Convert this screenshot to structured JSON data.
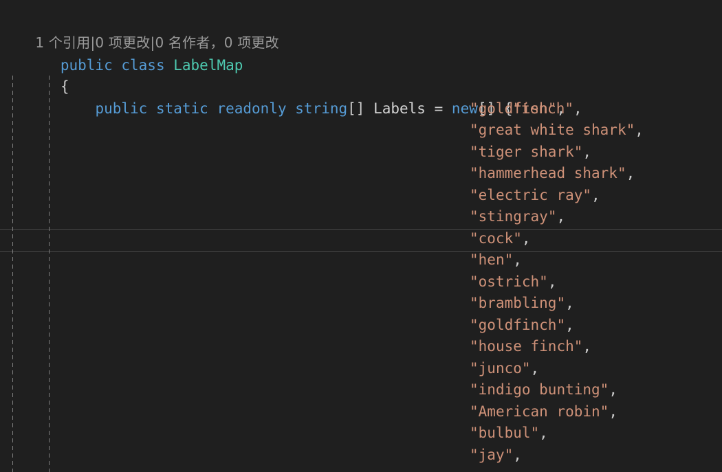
{
  "editor": {
    "language": "csharp",
    "background_color": "#1f1f1f",
    "font_size_px": 21,
    "line_height_px": 31.5,
    "current_line_number": 10,
    "colors": {
      "background": "#1f1f1f",
      "keyword": "#569cd6",
      "type_name": "#4ec9b0",
      "string": "#ce9178",
      "plain_text": "#d4d4d4",
      "punctuation": "#cccccc",
      "codelens": "#9a9a9a",
      "indent_guide": "#808080",
      "current_line_border": "#4a4a4a"
    }
  },
  "codelens": {
    "full_text": "1 个引用|0 项更改|0 名作者，0 项更改",
    "references": "1 个引用",
    "separator": "|",
    "changes": "0 项更改",
    "authors": "0 名作者，0 项更改"
  },
  "code": {
    "class_declaration": {
      "modifier": "public",
      "keyword": "class",
      "name": "LabelMap"
    },
    "open_brace": "{",
    "field_declaration": {
      "modifier1": "public",
      "modifier2": "static",
      "modifier3": "readonly",
      "type": "string",
      "array_suffix": "[]",
      "name": "Labels",
      "equals": "=",
      "new_keyword": "new",
      "new_suffix": "[]",
      "init_open": "{"
    },
    "quote": "\"",
    "comma": ",",
    "array_values": [
      "tench",
      "goldfish",
      "great white shark",
      "tiger shark",
      "hammerhead shark",
      "electric ray",
      "stingray",
      "cock",
      "hen",
      "ostrich",
      "brambling",
      "goldfinch",
      "house finch",
      "junco",
      "indigo bunting",
      "American robin",
      "bulbul",
      "jay"
    ]
  }
}
